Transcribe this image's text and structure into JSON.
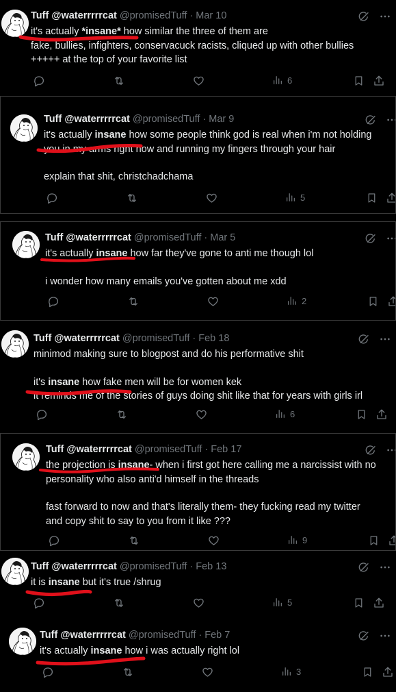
{
  "user": {
    "name": "Tuff @waterrrrrcat",
    "handle": "@promisedTuff"
  },
  "tweets": [
    {
      "date": "Mar 10",
      "lines": [
        {
          "pre": "it's actually ",
          "bold": "*insane*",
          "post": " how similar the three of them are"
        },
        {
          "pre": "fake, bullies, infighters, conservacuck racists, cliqued up with other bullies",
          "bold": "",
          "post": ""
        },
        {
          "pre": "+++++ at the top of your favorite list",
          "bold": "",
          "post": ""
        }
      ],
      "views": "6"
    },
    {
      "date": "Mar 9",
      "lines": [
        {
          "pre": "it's actually ",
          "bold": "insane",
          "post": " how some people think god is real when i'm not holding"
        },
        {
          "pre": "you in my arms right now and running my fingers through your hair",
          "bold": "",
          "post": ""
        },
        {
          "pre": "",
          "bold": "",
          "post": ""
        },
        {
          "pre": "explain that shit, christchadchama",
          "bold": "",
          "post": ""
        }
      ],
      "views": "5"
    },
    {
      "date": "Mar 5",
      "lines": [
        {
          "pre": "it's actually ",
          "bold": "insane",
          "post": " how far they've gone to anti me though lol"
        },
        {
          "pre": "",
          "bold": "",
          "post": ""
        },
        {
          "pre": "i wonder how many emails you've gotten about me xdd",
          "bold": "",
          "post": ""
        }
      ],
      "views": "2"
    },
    {
      "date": "Feb 18",
      "lines": [
        {
          "pre": "minimod making sure to blogpost and do his performative shit",
          "bold": "",
          "post": ""
        },
        {
          "pre": "",
          "bold": "",
          "post": ""
        },
        {
          "pre": "it's ",
          "bold": "insane",
          "post": " how fake men will be for women kek"
        },
        {
          "pre": "it reminds me of the stories of guys doing shit like that for years with girls irl",
          "bold": "",
          "post": ""
        }
      ],
      "views": "6"
    },
    {
      "date": "Feb 17",
      "lines": [
        {
          "pre": "the projection is ",
          "bold": "insane",
          "post": "- when i first got here calling me a narcissist with no"
        },
        {
          "pre": "personality who also anti'd himself in the threads",
          "bold": "",
          "post": ""
        },
        {
          "pre": "",
          "bold": "",
          "post": ""
        },
        {
          "pre": "fast forward to now and that's literally them- they fucking read my twitter",
          "bold": "",
          "post": ""
        },
        {
          "pre": "and copy shit to say to you from it like ???",
          "bold": "",
          "post": ""
        }
      ],
      "views": "9"
    },
    {
      "date": "Feb 13",
      "lines": [
        {
          "pre": "it is ",
          "bold": "insane",
          "post": " but it's true /shrug"
        }
      ],
      "views": "5"
    },
    {
      "date": "Feb 7",
      "lines": [
        {
          "pre": "it's actually ",
          "bold": "insane",
          "post": " how i was actually right lol"
        }
      ],
      "views": "3"
    }
  ],
  "icons": {
    "reply": "reply-icon",
    "retweet": "retweet-icon",
    "like": "like-icon",
    "views": "views-icon",
    "bookmark": "bookmark-icon",
    "share": "share-icon",
    "grok": "grok-icon",
    "more": "more-icon"
  },
  "colors": {
    "background": "#000000",
    "text": "#e7e9ea",
    "muted": "#71767b",
    "annotation": "#e0101a"
  }
}
